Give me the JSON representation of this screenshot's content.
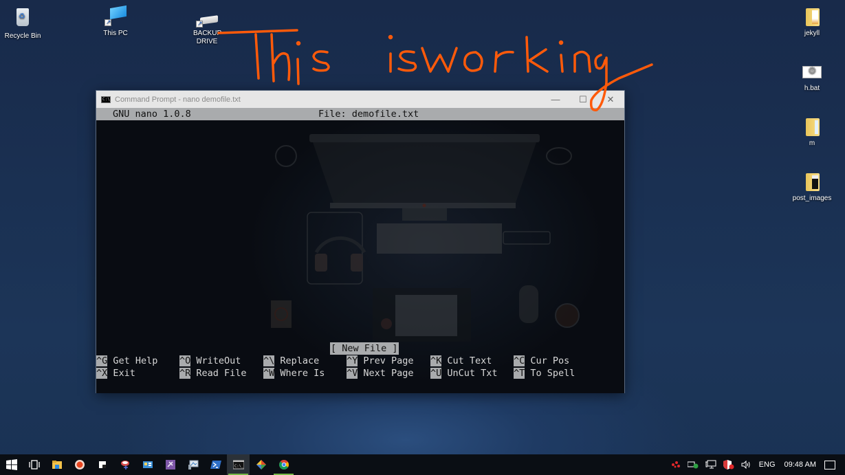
{
  "desktop": {
    "icons_left": [
      {
        "label": "Recycle Bin",
        "icon": "recycle-bin-icon"
      },
      {
        "label": "This PC",
        "icon": "this-pc-icon"
      },
      {
        "label": "BACKUP DRIVE",
        "icon": "drive-icon"
      }
    ],
    "icons_right": [
      {
        "label": "jekyll",
        "icon": "folder-icon"
      },
      {
        "label": "h.bat",
        "icon": "batch-file-icon"
      },
      {
        "label": "m",
        "icon": "folder-icon"
      },
      {
        "label": "post_images",
        "icon": "folder-icon"
      }
    ],
    "annotation": {
      "text": "This is working",
      "color": "#ff5a0a"
    }
  },
  "window": {
    "title": "Command Prompt - nano  demofile.txt",
    "minimize": "—",
    "maximize": "☐",
    "close": "✕",
    "nano": {
      "version": "GNU nano 1.0.8",
      "file": "File: demofile.txt",
      "status": "[ New File ]",
      "shortcuts_row1": [
        {
          "key": "^G",
          "label": "Get Help"
        },
        {
          "key": "^O",
          "label": "WriteOut"
        },
        {
          "key": "^\\",
          "label": "Replace"
        },
        {
          "key": "^Y",
          "label": "Prev Page"
        },
        {
          "key": "^K",
          "label": "Cut Text"
        },
        {
          "key": "^C",
          "label": "Cur Pos"
        }
      ],
      "shortcuts_row2": [
        {
          "key": "^X",
          "label": "Exit"
        },
        {
          "key": "^R",
          "label": "Read File"
        },
        {
          "key": "^W",
          "label": "Where Is"
        },
        {
          "key": "^V",
          "label": "Next Page"
        },
        {
          "key": "^U",
          "label": "UnCut Txt"
        },
        {
          "key": "^T",
          "label": "To Spell"
        }
      ]
    }
  },
  "taskbar": {
    "items": [
      {
        "name": "start",
        "icon": "windows-start-icon"
      },
      {
        "name": "task-view",
        "icon": "task-view-icon"
      },
      {
        "name": "file-explorer",
        "icon": "file-explorer-icon"
      },
      {
        "name": "recorder",
        "icon": "record-icon"
      },
      {
        "name": "sticky-app",
        "icon": "app-icon"
      },
      {
        "name": "network-tool",
        "icon": "network-tool-icon"
      },
      {
        "name": "control-panel",
        "icon": "control-panel-icon"
      },
      {
        "name": "visual-studio",
        "icon": "visual-studio-icon"
      },
      {
        "name": "remote-desktop",
        "icon": "remote-desktop-icon"
      },
      {
        "name": "powershell",
        "icon": "powershell-icon"
      },
      {
        "name": "command-prompt",
        "icon": "command-prompt-icon",
        "active": true
      },
      {
        "name": "git",
        "icon": "git-icon"
      },
      {
        "name": "chrome",
        "icon": "chrome-icon",
        "running": true
      }
    ],
    "tray": {
      "language": "ENG",
      "time": "09:48 AM"
    }
  }
}
